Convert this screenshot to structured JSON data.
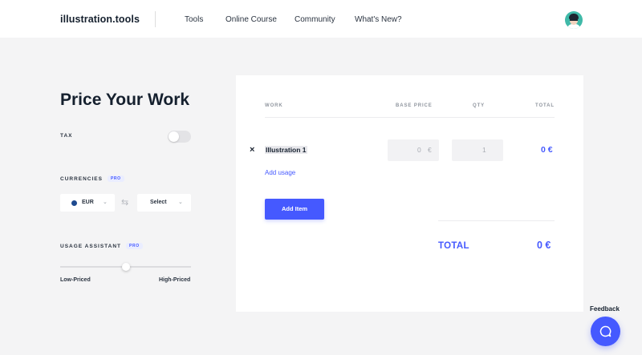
{
  "nav": {
    "brand": "illustration.tools",
    "links": [
      "Tools",
      "Online Course",
      "Community",
      "What's New?"
    ]
  },
  "sidebar": {
    "title": "Price Your Work",
    "tax_label": "TAX",
    "tax_enabled": false,
    "currencies_label": "CURRENCIES",
    "currencies_badge": "PRO",
    "currency_from": "EUR",
    "currency_to": "Select",
    "usage_label": "USAGE ASSISTANT",
    "usage_badge": "PRO",
    "usage_level": 0.5,
    "range_low": "Low-Priced",
    "range_high": "High-Priced"
  },
  "table": {
    "headers": {
      "work": "WORK",
      "base_price": "BASE PRICE",
      "qty": "QTY",
      "total": "TOTAL"
    },
    "items": [
      {
        "name": "Illustration 1",
        "base_price": "0",
        "currency_symbol": "€",
        "qty": "1",
        "total": "0 €"
      }
    ],
    "add_usage": "Add usage",
    "add_item": "Add Item",
    "total_label": "TOTAL",
    "total_value": "0 €"
  },
  "feedback": {
    "label": "Feedback"
  },
  "icons": {
    "remove": "close-icon",
    "swap": "swap-arrows-icon",
    "chevron": "chevron-down-icon",
    "feedback": "chat-bubble-icon"
  },
  "colors": {
    "accent": "#4559ff",
    "avatar_bg": "#3fb9a8",
    "flag": "#1e4a8f"
  }
}
